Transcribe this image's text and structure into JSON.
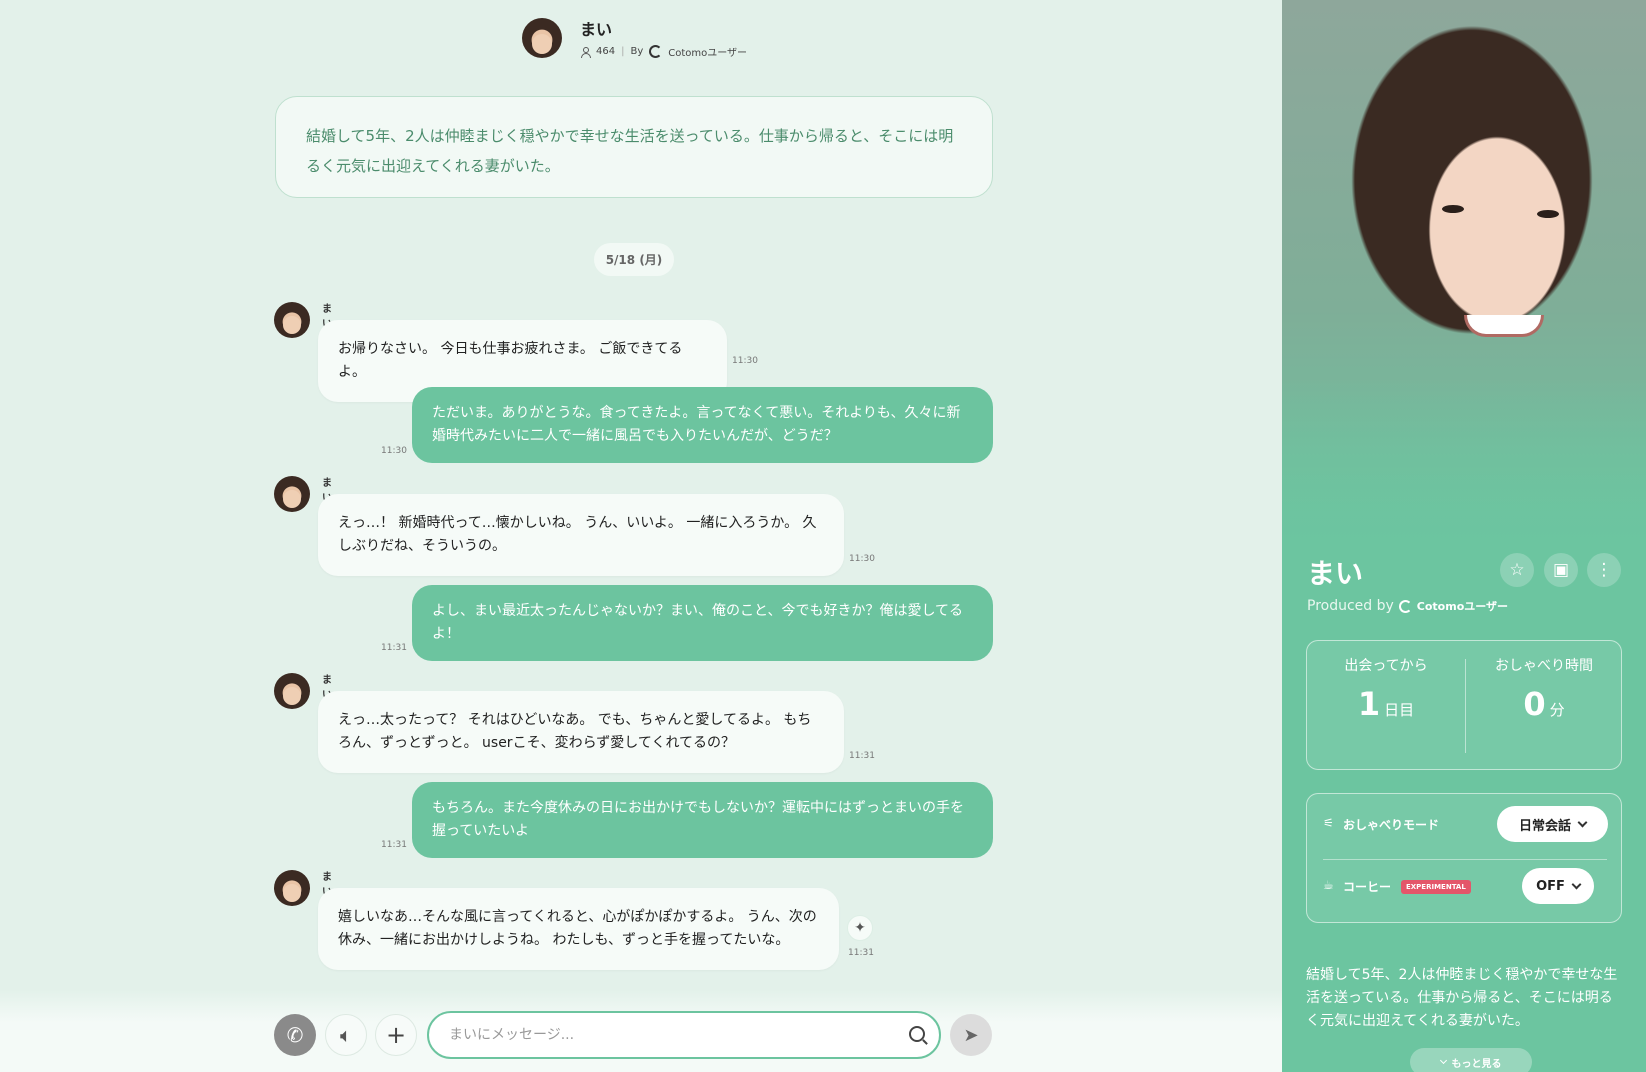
{
  "header": {
    "name": "まい",
    "count": "464",
    "by": "By",
    "author": "Cotomoユーザー"
  },
  "intro": "結婚して5年、2人は仲睦まじく穏やかで幸せな生活を送っている。仕事から帰ると、そこには明るく元気に出迎えてくれる妻がいた。",
  "date_label": "5/18 (月)",
  "messages": [
    {
      "role": "ai",
      "name": "まい",
      "text": "お帰りなさい。 今日も仕事お疲れさま。 ご飯できてるよ。",
      "time": "11:30"
    },
    {
      "role": "user",
      "text": "ただいま。ありがとうな。食ってきたよ。言ってなくて悪い。それよりも、久々に新婚時代みたいに二人で一緒に風呂でも入りたいんだが、どうだ？",
      "time": "11:30"
    },
    {
      "role": "ai",
      "name": "まい",
      "text": "えっ…！ 新婚時代って…懐かしいね。 うん、いいよ。 一緒に入ろうか。 久しぶりだね、そういうの。",
      "time": "11:30"
    },
    {
      "role": "user",
      "text": "よし、まい最近太ったんじゃないか？まい、俺のこと、今でも好きか？俺は愛してるよ！",
      "time": "11:31"
    },
    {
      "role": "ai",
      "name": "まい",
      "text": "えっ…太ったって？ それはひどいなあ。 でも、ちゃんと愛してるよ。 もちろん、ずっとずっと。 userこそ、変わらず愛してくれてるの？",
      "time": "11:31"
    },
    {
      "role": "user",
      "text": "もちろん。また今度休みの日にお出かけでもしないか？運転中にはずっとまいの手を握っていたいよ",
      "time": "11:31"
    },
    {
      "role": "ai",
      "name": "まい",
      "text": "嬉しいなあ…そんな風に言ってくれると、心がぽかぽかするよ。 うん、次の休み、一緒にお出かけしようね。 わたしも、ずっと手を握ってたいな。",
      "time": "11:31"
    }
  ],
  "input": {
    "placeholder": "まいにメッセージ..."
  },
  "icons": {
    "call": "phone-icon",
    "volume": "speaker-icon",
    "plus": "plus-icon",
    "send": "send-icon",
    "search": "search-icon",
    "star": "star-icon",
    "image": "image-icon",
    "more": "more-vertical-icon",
    "regen": "sparkle-icon"
  },
  "panel": {
    "name": "まい",
    "produced_by": "Produced by",
    "author": "Cotomoユーザー",
    "stats": [
      {
        "label": "出会ってから",
        "value": "1",
        "unit": "日目"
      },
      {
        "label": "おしゃべり時間",
        "value": "0",
        "unit": "分"
      }
    ],
    "settings": {
      "mode_label": "おしゃべりモード",
      "mode_value": "日常会話",
      "coffee_label": "コーヒー",
      "coffee_badge": "EXPERIMENTAL",
      "coffee_value": "OFF"
    },
    "description": "結婚して5年、2人は仲睦まじく穏やかで幸せな生活を送っている。仕事から帰ると、そこには明るく元気に出迎えてくれる妻がいた。",
    "more_label": "もっと見る"
  },
  "colors": {
    "accent": "#6cc49f",
    "background": "#e3f1ea",
    "badge": "#e4566a"
  }
}
